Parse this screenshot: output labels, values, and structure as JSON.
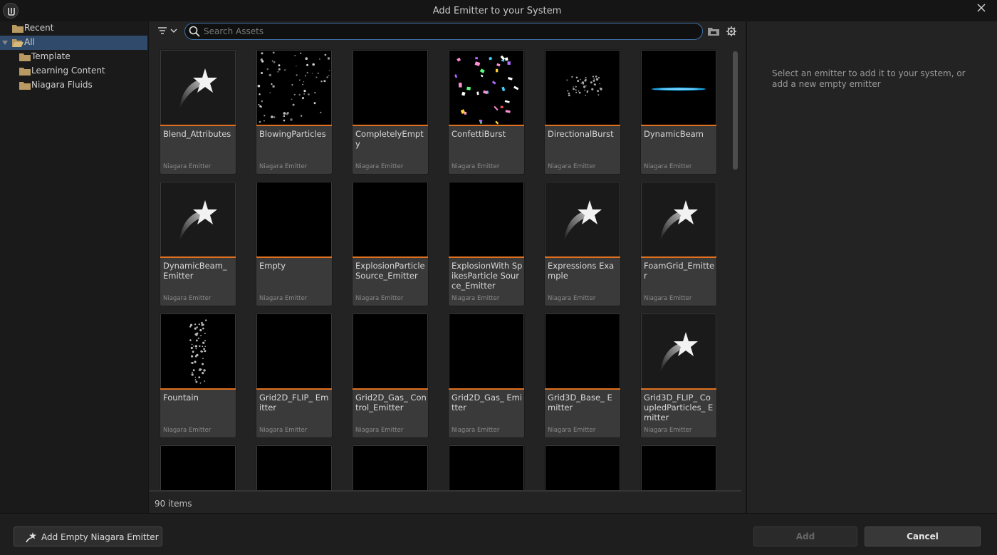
{
  "window": {
    "title": "Add Emitter to your System"
  },
  "tree": {
    "items": [
      {
        "label": "Recent",
        "selected": false
      },
      {
        "label": "All",
        "selected": true
      },
      {
        "label": "Template",
        "selected": false
      },
      {
        "label": "Learning Content",
        "selected": false
      },
      {
        "label": "Niagara Fluids",
        "selected": false
      }
    ]
  },
  "search": {
    "placeholder": "Search Assets",
    "value": ""
  },
  "assets": [
    {
      "name": "Blend_Attributes",
      "type": "Niagara Emitter",
      "thumb": "star"
    },
    {
      "name": "BlowingParticles",
      "type": "Niagara Emitter",
      "thumb": "particles"
    },
    {
      "name": "CompletelyEmpty",
      "type": "Niagara Emitter",
      "thumb": "black"
    },
    {
      "name": "ConfettiBurst",
      "type": "Niagara Emitter",
      "thumb": "confetti"
    },
    {
      "name": "DirectionalBurst",
      "type": "Niagara Emitter",
      "thumb": "burst"
    },
    {
      "name": "DynamicBeam",
      "type": "Niagara Emitter",
      "thumb": "beam"
    },
    {
      "name": "DynamicBeam_ Emitter",
      "type": "Niagara Emitter",
      "thumb": "star"
    },
    {
      "name": "Empty",
      "type": "Niagara Emitter",
      "thumb": "black"
    },
    {
      "name": "ExplosionParticle Source_Emitter",
      "type": "Niagara Emitter",
      "thumb": "black"
    },
    {
      "name": "ExplosionWith SpikesParticle Source_Emitter",
      "type": "Niagara Emitter",
      "thumb": "black"
    },
    {
      "name": "Expressions Example",
      "type": "Niagara Emitter",
      "thumb": "star"
    },
    {
      "name": "FoamGrid_Emitter",
      "type": "Niagara Emitter",
      "thumb": "star"
    },
    {
      "name": "Fountain",
      "type": "Niagara Emitter",
      "thumb": "fountain"
    },
    {
      "name": "Grid2D_FLIP_ Emitter",
      "type": "Niagara Emitter",
      "thumb": "black"
    },
    {
      "name": "Grid2D_Gas_ Control_Emitter",
      "type": "Niagara Emitter",
      "thumb": "black"
    },
    {
      "name": "Grid2D_Gas_ Emitter",
      "type": "Niagara Emitter",
      "thumb": "black"
    },
    {
      "name": "Grid3D_Base_ Emitter",
      "type": "Niagara Emitter",
      "thumb": "black"
    },
    {
      "name": "Grid3D_FLIP_ CoupledParticles_ Emitter",
      "type": "Niagara Emitter",
      "thumb": "star"
    },
    {
      "name": "",
      "type": "",
      "thumb": "black"
    },
    {
      "name": "",
      "type": "",
      "thumb": "black"
    },
    {
      "name": "",
      "type": "",
      "thumb": "black"
    },
    {
      "name": "",
      "type": "",
      "thumb": "black"
    },
    {
      "name": "",
      "type": "",
      "thumb": "black"
    },
    {
      "name": "",
      "type": "",
      "thumb": "black"
    }
  ],
  "status": {
    "item_count": "90 items"
  },
  "details": {
    "hint": "Select an emitter to add it to your system, or add a new empty emitter"
  },
  "footer": {
    "add_empty_label": "Add Empty Niagara Emitter",
    "add_label": "Add",
    "cancel_label": "Cancel"
  },
  "colors": {
    "accent": "#e0701e",
    "selection": "#2f4a6a",
    "search_border": "#3d6fa8"
  }
}
